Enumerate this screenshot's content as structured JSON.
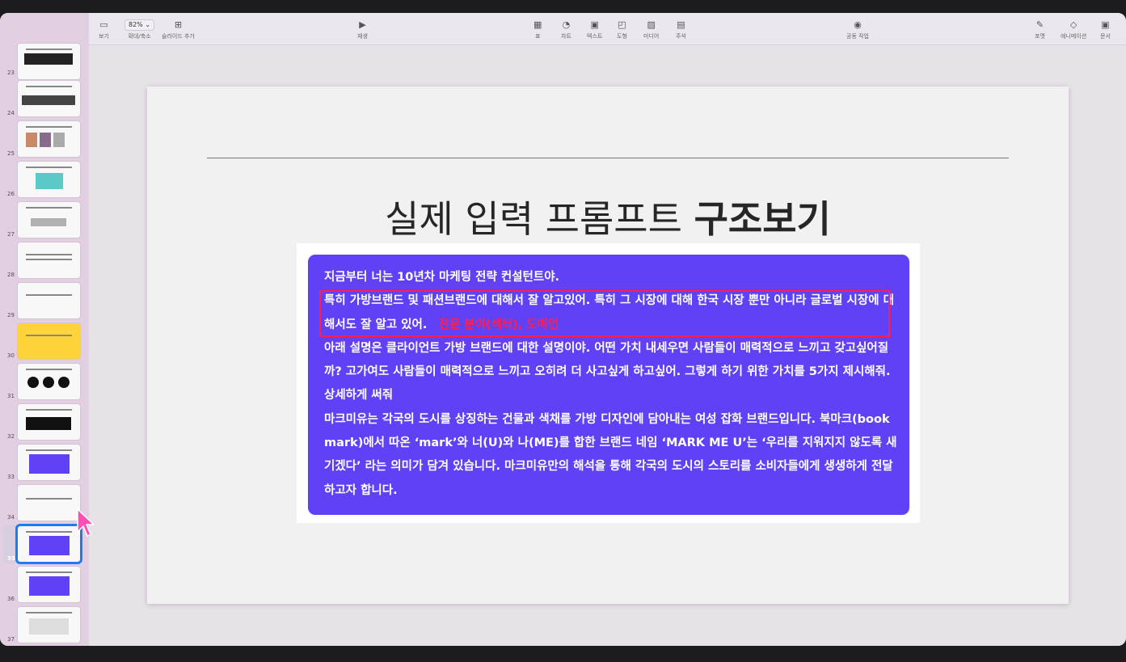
{
  "toolbar": {
    "view_label": "보기",
    "zoom_value": "82%",
    "zoom_label": "확대/축소",
    "add_slide_label": "슬라이드 추가",
    "play_label": "재생",
    "table_label": "표",
    "chart_label": "차트",
    "text_label": "텍스트",
    "shape_label": "도형",
    "media_label": "미디어",
    "comment_label": "주석",
    "collab_label": "공동 작업",
    "format_label": "포맷",
    "animate_label": "애니메이션",
    "document_label": "문서"
  },
  "sidebar": {
    "slides": [
      {
        "number": "23"
      },
      {
        "number": "24"
      },
      {
        "number": "25"
      },
      {
        "number": "26"
      },
      {
        "number": "27"
      },
      {
        "number": "28"
      },
      {
        "number": "29"
      },
      {
        "number": "30"
      },
      {
        "number": "31"
      },
      {
        "number": "32"
      },
      {
        "number": "33"
      },
      {
        "number": "34"
      },
      {
        "number": "35",
        "selected": true
      },
      {
        "number": "36"
      },
      {
        "number": "37"
      }
    ]
  },
  "slide": {
    "title_light": "실제 입력 프롬프트 ",
    "title_bold": "구조보기",
    "para1": "지금부터 너는 10년차 마케팅 전략 컨설턴트야.",
    "para2": "특히 가방브랜드 및 패션브랜드에 대해서 잘 알고있어. 특히 그 시장에 대해 한국 시장 뿐만 아니라 글로벌 시장에 대해서도 잘 알고 있어.",
    "highlight_label": "전문 분야(섹터), 도메인",
    "para3": "아래 설명은 클라이언트 가방 브랜드에 대한 설명이야. 어떤 가치 내세우면 사람들이 매력적으로 느끼고 갖고싶어질까? 고가여도 사람들이 매력적으로 느끼고 오히려 더 사고싶게 하고싶어. 그렇게 하기 위한 가치를 5가지 제시해줘. 상세하게 써줘",
    "para4": "마크미유는 각국의 도시를 상징하는 건물과 색채를 가방 디자인에 담아내는 여성 잡화 브랜드입니다. 북마크(book mark)에서 따온 ‘mark’와 너(U)와 나(ME)를 합한 브랜드 네임 ‘MARK ME U’는 ‘우리를 지워지지 않도록 새기겠다’ 라는 의미가 담겨 있습니다. 마크미유만의 해석을 통해 각국의 도시의 스토리를 소비자들에게 생생하게 전달하고자 합니다."
  },
  "colors": {
    "prompt_box": "#6141f6",
    "highlight": "#ff1e4e",
    "selection": "#1f7bf5",
    "sidebar_bg": "#e3cfe2"
  }
}
